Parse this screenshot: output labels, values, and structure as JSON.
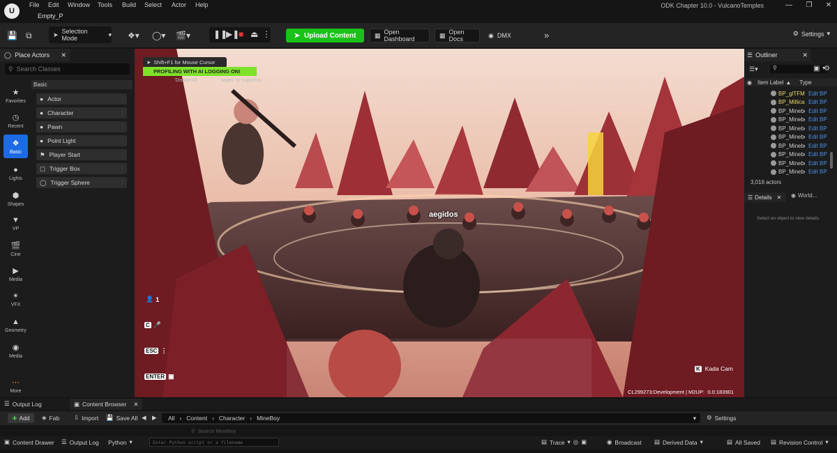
{
  "menubar": {
    "items": [
      "File",
      "Edit",
      "Window",
      "Tools",
      "Build",
      "Select",
      "Actor",
      "Help"
    ],
    "level_tab": "Empty_P",
    "window_title": "ODK Chapter 10.0 - VulcanoTemples"
  },
  "toolbar": {
    "selection_mode": "Selection Mode",
    "upload_content": "Upload Content",
    "open_dashboard": "Open Dashboard",
    "open_docs": "Open Docs",
    "dmx": "DMX",
    "settings": "Settings"
  },
  "left_panel": {
    "tab": "Place Actors",
    "search_placeholder": "Search Classes",
    "section": "Basic",
    "categories": [
      "Favorites",
      "Recent",
      "Basic",
      "Lights",
      "Shapes",
      "VP",
      "Cine",
      "Media",
      "VFX",
      "Geometry",
      "Media",
      "More"
    ],
    "actors": [
      "Actor",
      "Character",
      "Pawn",
      "Point Light",
      "Player Start",
      "Trigger Box",
      "Trigger Sphere"
    ]
  },
  "viewport": {
    "cursor_hint": "Shift+F1 for Mouse Cursor",
    "profiling": "PROFILING WITH AI LOGGING ON!",
    "suppress_left": "'DisableAll",
    "suppress_right": "sages' to suppress",
    "player_name": "aegidos",
    "players_count": "1",
    "c_key": "C",
    "esc_key": "ESC",
    "enter_key": "ENTER",
    "kada_key": "K",
    "kada_cam": "Kada Cam",
    "build_info": "CL299273:Development | M2UP:   0.0:183901"
  },
  "outliner": {
    "tab": "Outliner",
    "col_label": "Item Label",
    "col_type": "Type",
    "rows": [
      {
        "label": "BP_glTFMa",
        "type": "Edit BP",
        "yellow": true
      },
      {
        "label": "BP_Millicas",
        "type": "Edit BP",
        "yellow": true
      },
      {
        "label": "BP_Mineboy",
        "type": "Edit BP",
        "yellow": false
      },
      {
        "label": "BP_Mineboy",
        "type": "Edit BP",
        "yellow": false
      },
      {
        "label": "BP_Mineboy",
        "type": "Edit BP",
        "yellow": false
      },
      {
        "label": "BP_Mineboy",
        "type": "Edit BP",
        "yellow": false
      },
      {
        "label": "BP_Mineboy",
        "type": "Edit BP",
        "yellow": false
      },
      {
        "label": "BP_Mineboy",
        "type": "Edit BP",
        "yellow": false
      },
      {
        "label": "BP_Mineboy",
        "type": "Edit BP",
        "yellow": false
      },
      {
        "label": "BP_Mineboy",
        "type": "Edit BP",
        "yellow": false
      }
    ],
    "actors_count": "3,016 actors"
  },
  "details": {
    "tab": "Details",
    "world_tab": "World...",
    "empty_text": "Select an object to view details."
  },
  "bottom": {
    "output_log_tab": "Output Log",
    "content_browser_tab": "Content Browser",
    "add": "Add",
    "fab": "Fab",
    "import": "Import",
    "save_all": "Save All",
    "path": [
      "All",
      "Content",
      "Character",
      "MineBoy"
    ],
    "settings": "Settings",
    "search_hint": "Search MineBoy"
  },
  "statusbar": {
    "content_drawer": "Content Drawer",
    "output_log": "Output Log",
    "python": "Python",
    "python_placeholder": "Enter Python script or a filename",
    "trace": "Trace",
    "broadcast": "Broadcast",
    "derived_data": "Derived Data",
    "all_saved": "All Saved",
    "revision_control": "Revision Control"
  },
  "colors": {
    "accent_blue": "#1d6ae5",
    "upload_green": "#19c119",
    "profiling_green": "#7ee22a",
    "link_blue": "#4a8fe8"
  }
}
